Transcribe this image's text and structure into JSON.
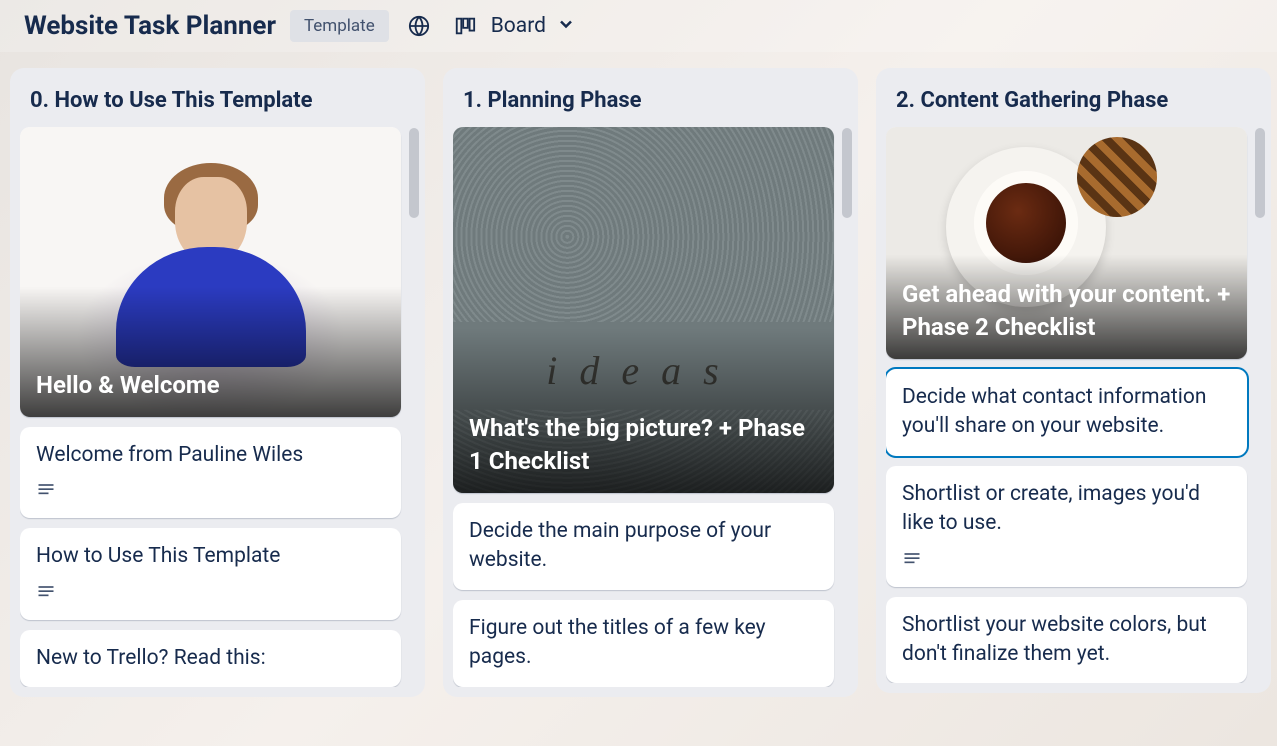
{
  "header": {
    "title": "Website Task Planner",
    "template_badge": "Template",
    "view_label": "Board"
  },
  "lists": [
    {
      "title": "0. How to Use This Template",
      "cover_card": {
        "title": "Hello & Welcome"
      },
      "cards": [
        {
          "title": "Welcome from Pauline Wiles",
          "has_description": true
        },
        {
          "title": "How to Use This Template",
          "has_description": true
        },
        {
          "title": "New to Trello? Read this:"
        }
      ]
    },
    {
      "title": "1. Planning Phase",
      "cover_card": {
        "title": "What's the big picture? + Phase 1 Checklist"
      },
      "cards": [
        {
          "title": "Decide the main purpose of your website."
        },
        {
          "title": "Figure out the titles of a few key pages."
        }
      ]
    },
    {
      "title": "2. Content Gathering Phase",
      "cover_card": {
        "title": "Get ahead with your content. + Phase 2 Checklist"
      },
      "cards": [
        {
          "title": "Decide what contact information you'll share on your website.",
          "selected": true
        },
        {
          "title": "Shortlist or create, images you'd like to use.",
          "has_description": true
        },
        {
          "title": "Shortlist your website colors, but don't finalize them yet."
        }
      ]
    }
  ]
}
